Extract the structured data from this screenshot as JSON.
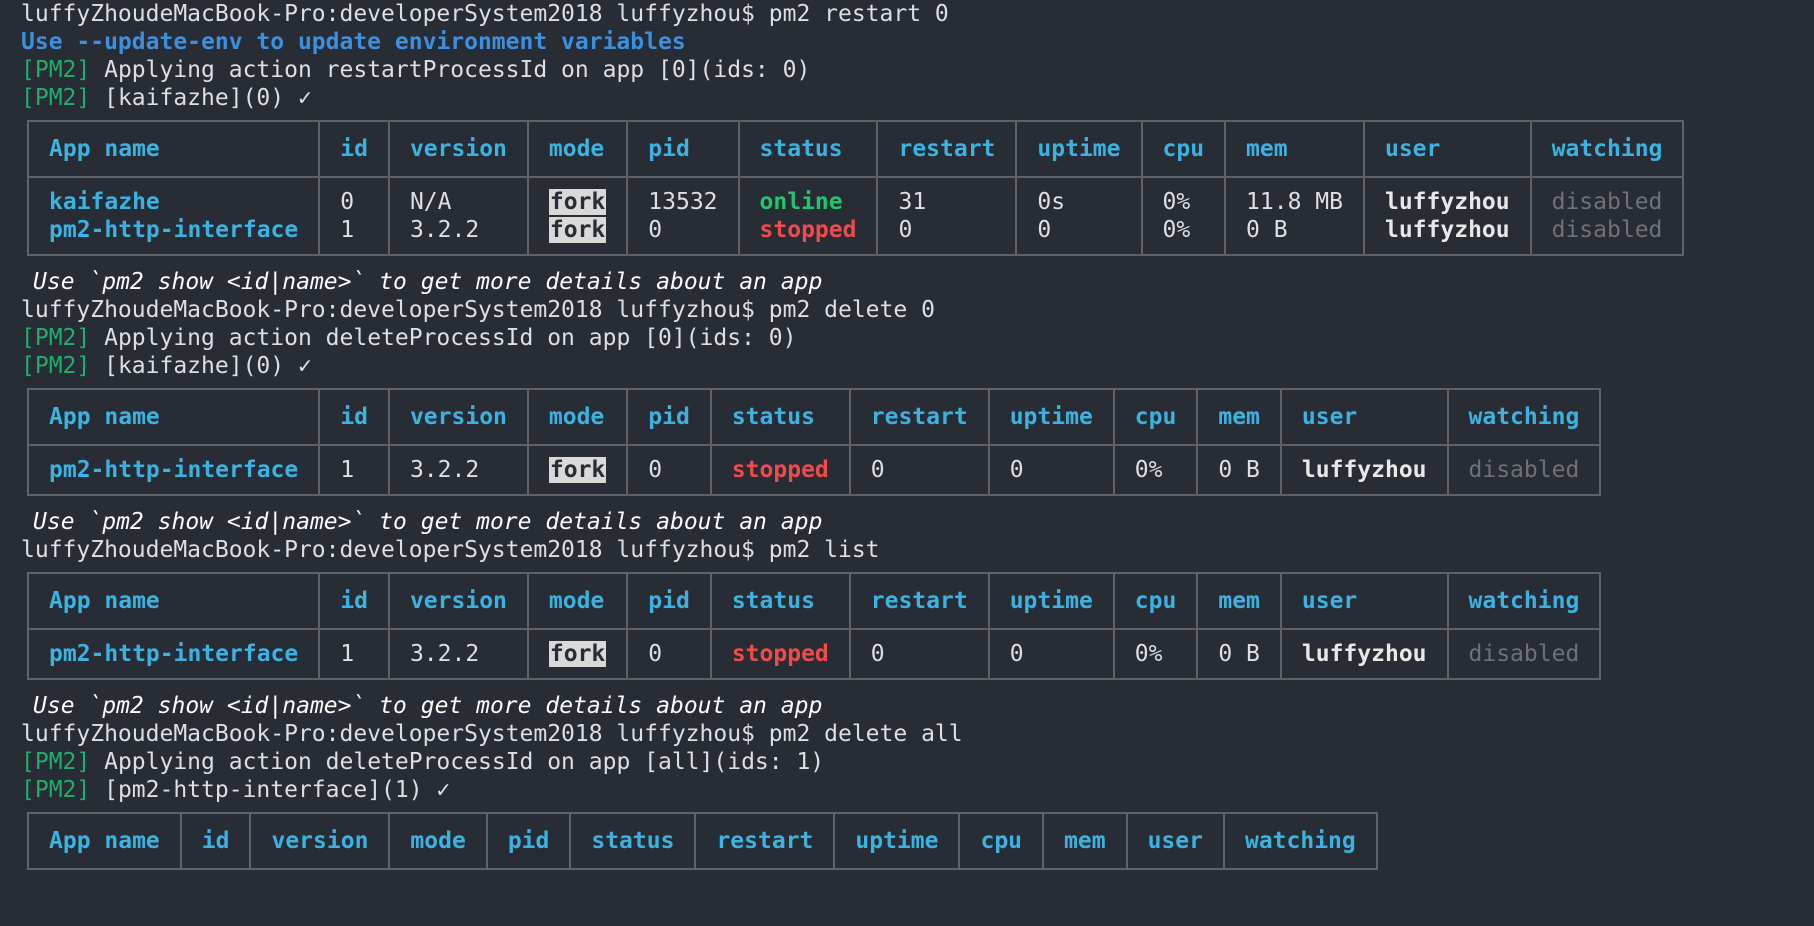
{
  "block1": {
    "prompt": "luffyZhoudeMacBook-Pro:developerSystem2018 luffyzhou$ pm2 restart 0",
    "hint": "Use --update-env to update environment variables",
    "tag": "[PM2]",
    "msg1": " Applying action restartProcessId on app [0](ids: 0)",
    "msg2": " [kaifazhe](0) ✓"
  },
  "block2": {
    "prompt": "luffyZhoudeMacBook-Pro:developerSystem2018 luffyzhou$ pm2 delete 0",
    "tag": "[PM2]",
    "msg1": " Applying action deleteProcessId on app [0](ids: 0)",
    "msg2": " [kaifazhe](0) ✓"
  },
  "block3": {
    "prompt": "luffyZhoudeMacBook-Pro:developerSystem2018 luffyzhou$ pm2 list"
  },
  "block4": {
    "prompt": "luffyZhoudeMacBook-Pro:developerSystem2018 luffyzhou$ pm2 delete all",
    "tag": "[PM2]",
    "msg1": " Applying action deleteProcessId on app [all](ids: 1)",
    "msg2": " [pm2-http-interface](1) ✓"
  },
  "show_note": "Use `pm2 show <id|name>` to get more details about an app",
  "headers": [
    "App name",
    "id",
    "version",
    "mode",
    "pid",
    "status",
    "restart",
    "uptime",
    "cpu",
    "mem",
    "user",
    "watching"
  ],
  "table1": [
    {
      "name": "kaifazhe",
      "id": "0",
      "version": "N/A",
      "mode": "fork",
      "pid": "13532",
      "status": "online",
      "restart": "31",
      "uptime": "0s",
      "cpu": "0%",
      "mem": "11.8 MB",
      "user": "luffyzhou",
      "watching": "disabled"
    },
    {
      "name": "pm2-http-interface",
      "id": "1",
      "version": "3.2.2",
      "mode": "fork",
      "pid": "0",
      "status": "stopped",
      "restart": "0",
      "uptime": "0",
      "cpu": "0%",
      "mem": "0 B",
      "user": "luffyzhou",
      "watching": "disabled"
    }
  ],
  "table2": [
    {
      "name": "pm2-http-interface",
      "id": "1",
      "version": "3.2.2",
      "mode": "fork",
      "pid": "0",
      "status": "stopped",
      "restart": "0",
      "uptime": "0",
      "cpu": "0%",
      "mem": "0 B",
      "user": "luffyzhou",
      "watching": "disabled"
    }
  ],
  "table3": [
    {
      "name": "pm2-http-interface",
      "id": "1",
      "version": "3.2.2",
      "mode": "fork",
      "pid": "0",
      "status": "stopped",
      "restart": "0",
      "uptime": "0",
      "cpu": "0%",
      "mem": "0 B",
      "user": "luffyzhou",
      "watching": "disabled"
    }
  ],
  "table4": [],
  "colors": {
    "background": "#282c34",
    "header": "#3ab3e3",
    "online": "#22c56e",
    "stopped": "#ef4b4b",
    "pm2_tag": "#1fae6e",
    "hint": "#3d8fe0",
    "border": "#5f6368"
  }
}
